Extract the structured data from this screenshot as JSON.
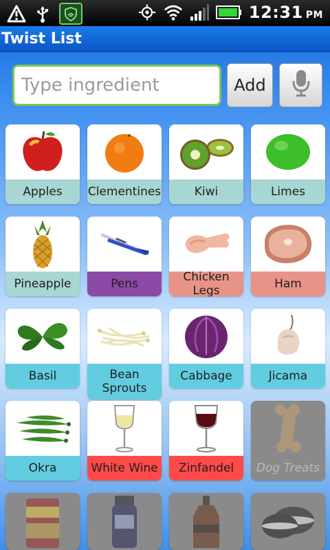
{
  "status_bar": {
    "time": "12:31",
    "ampm": "PM"
  },
  "app": {
    "title": "Twist List"
  },
  "input": {
    "placeholder": "Type ingredient",
    "add_label": "Add"
  },
  "colors": {
    "label_teal": "#a8d6d2",
    "label_cyan": "#62cde0",
    "label_purple": "#8a4aa6",
    "label_salmon": "#e89388",
    "label_red": "#ff4a4a"
  },
  "items": [
    {
      "label": "Apples",
      "icon": "apple-icon"
    },
    {
      "label": "Clementines",
      "icon": "clementine-icon"
    },
    {
      "label": "Kiwi",
      "icon": "kiwi-icon"
    },
    {
      "label": "Limes",
      "icon": "lime-icon"
    },
    {
      "label": "Pineapple",
      "icon": "pineapple-icon"
    },
    {
      "label": "Pens",
      "icon": "pen-icon"
    },
    {
      "label": "Chicken Legs",
      "icon": "chicken-leg-icon"
    },
    {
      "label": "Ham",
      "icon": "ham-icon"
    },
    {
      "label": "Basil",
      "icon": "basil-icon"
    },
    {
      "label": "Bean Sprouts",
      "icon": "bean-sprouts-icon"
    },
    {
      "label": "Cabbage",
      "icon": "cabbage-icon"
    },
    {
      "label": "Jicama",
      "icon": "jicama-icon"
    },
    {
      "label": "Okra",
      "icon": "okra-icon"
    },
    {
      "label": "White Wine",
      "icon": "white-wine-icon"
    },
    {
      "label": "Zinfandel",
      "icon": "red-wine-icon"
    },
    {
      "label": "Dog Treats",
      "icon": "dog-bone-icon"
    },
    {
      "label": "",
      "icon": "canned-food-icon"
    },
    {
      "label": "",
      "icon": "jam-jar-icon"
    },
    {
      "label": "",
      "icon": "bottle-icon"
    },
    {
      "label": "",
      "icon": "cookie-icon"
    }
  ]
}
